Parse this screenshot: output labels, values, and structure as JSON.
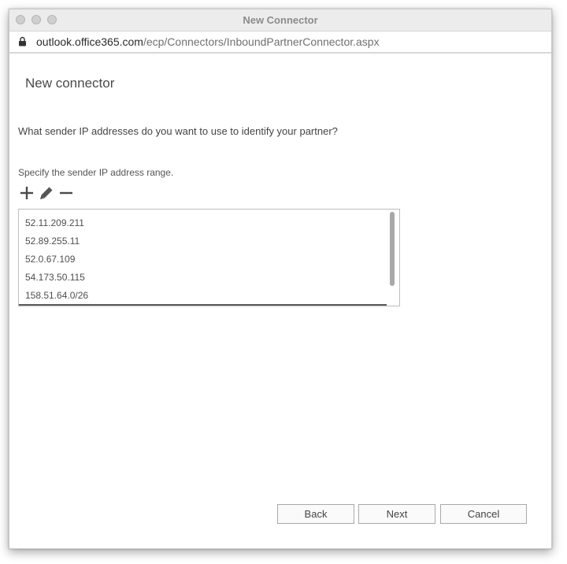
{
  "window": {
    "title": "New Connector"
  },
  "address_bar": {
    "host": "outlook.office365.com",
    "path": "/ecp/Connectors/InboundPartnerConnector.aspx"
  },
  "page": {
    "heading": "New connector",
    "question": "What sender IP addresses do you want to use to identify your partner?",
    "instruction": "Specify the sender IP address range."
  },
  "toolbar": {
    "icons": [
      "plus-icon",
      "pencil-icon",
      "minus-icon"
    ]
  },
  "ip_list": {
    "items": [
      "52.11.209.211",
      "52.89.255.11",
      "52.0.67.109",
      "54.173.50.115",
      "158.51.64.0/26"
    ]
  },
  "buttons": {
    "back": "Back",
    "next": "Next",
    "cancel": "Cancel"
  }
}
